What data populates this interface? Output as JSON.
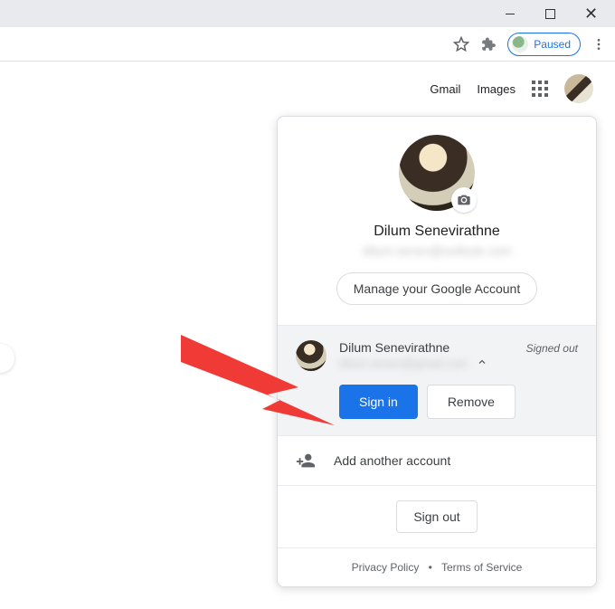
{
  "window": {
    "minimize": "minimize",
    "maximize": "restore",
    "close": "close"
  },
  "omnibar": {
    "paused_label": "Paused"
  },
  "gheader": {
    "gmail": "Gmail",
    "images": "Images"
  },
  "popup": {
    "primary_name": "Dilum Senevirathne",
    "primary_email_obscured": "dilum.senev@outlook.com",
    "manage_label": "Manage your Google Account",
    "alt_name": "Dilum Senevirathne",
    "alt_email_obscured": "dilum.senev@gmail.com",
    "signed_out_label": "Signed out",
    "sign_in_label": "Sign in",
    "remove_label": "Remove",
    "add_label": "Add another account",
    "signout_label": "Sign out",
    "privacy_label": "Privacy Policy",
    "terms_label": "Terms of Service"
  }
}
